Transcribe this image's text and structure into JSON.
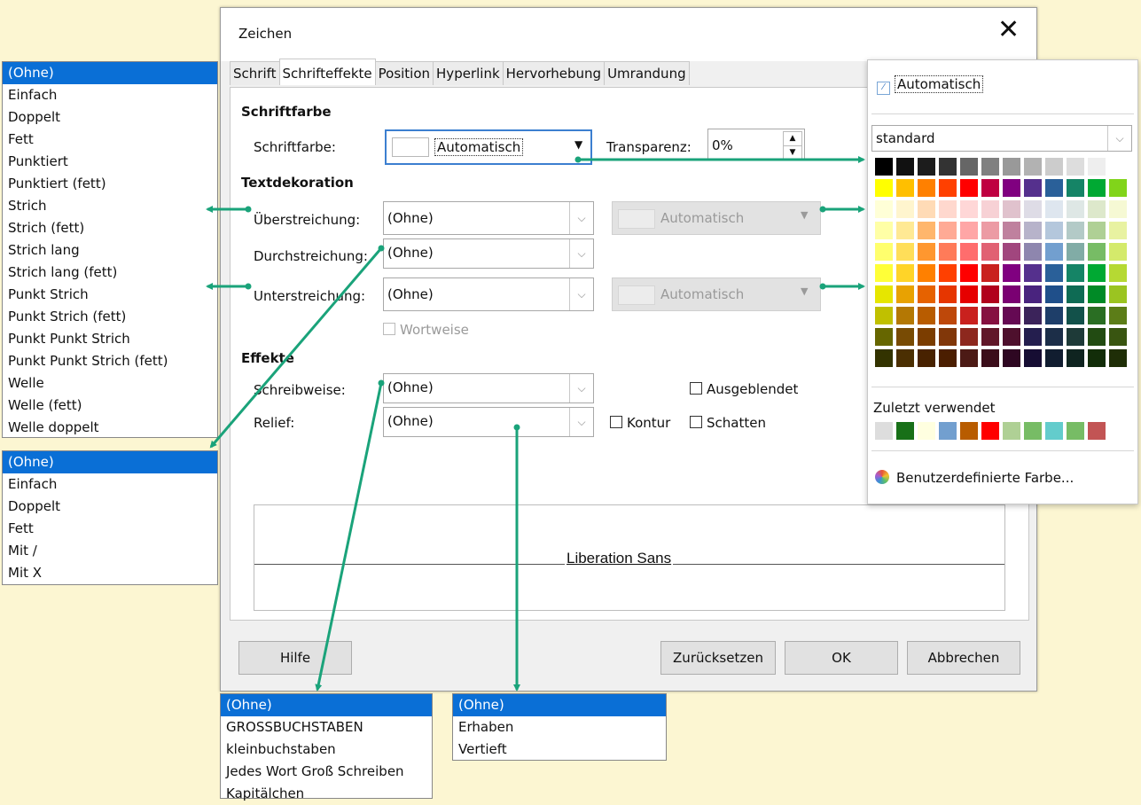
{
  "dialog": {
    "title": "Zeichen",
    "close": "✕",
    "tabs": [
      "Schrift",
      "Schrifteffekte",
      "Position",
      "Hyperlink",
      "Hervorhebung",
      "Umrandung"
    ],
    "active_tab": "Schrifteffekte",
    "sections": {
      "font_color": "Schriftfarbe",
      "decoration": "Textdekoration",
      "effects": "Effekte"
    },
    "font_color_label": "Schriftfarbe:",
    "font_color_value": "Automatisch",
    "transparency_label": "Transparenz:",
    "transparency_value": "0%",
    "overline_label": "Überstreichung:",
    "overline_value": "(Ohne)",
    "overline_color": "Automatisch",
    "strikeout_label": "Durchstreichung:",
    "strikeout_value": "(Ohne)",
    "underline_label": "Unterstreichung:",
    "underline_value": "(Ohne)",
    "underline_color": "Automatisch",
    "wordwise": "Wortweise",
    "case_label": "Schreibweise:",
    "case_value": "(Ohne)",
    "relief_label": "Relief:",
    "relief_value": "(Ohne)",
    "hidden": "Ausgeblendet",
    "outline": "Kontur",
    "shadow": "Schatten",
    "preview_text": "Liberation Sans",
    "buttons": {
      "help": "Hilfe",
      "reset": "Zurücksetzen",
      "ok": "OK",
      "cancel": "Abbrechen"
    }
  },
  "picker": {
    "auto": "Automatisch",
    "palette": "standard",
    "recent_label": "Zuletzt verwendet",
    "custom": "Benutzerdefinierte Farbe...",
    "grid": [
      [
        "#000000",
        "#111111",
        "#1c1c1c",
        "#333333",
        "#666666",
        "#808080",
        "#999999",
        "#b2b2b2",
        "#cccccc",
        "#dddddd",
        "#eeeeee",
        "#ffffff"
      ],
      [
        "#ffff00",
        "#ffbf00",
        "#ff8000",
        "#ff4000",
        "#ff0000",
        "#bf0041",
        "#800080",
        "#55308d",
        "#2a6099",
        "#158466",
        "#00a933",
        "#81d41a"
      ],
      [
        "#ffffd7",
        "#fff5ce",
        "#ffdbb6",
        "#ffd8ce",
        "#ffd7d7",
        "#f7d1d5",
        "#e0c2cd",
        "#dedce6",
        "#dee6ef",
        "#dee7e5",
        "#dde8cb",
        "#f6f9d4"
      ],
      [
        "#ffffa6",
        "#ffe994",
        "#ffb66c",
        "#ffaa95",
        "#ffa6a6",
        "#ec9ba4",
        "#bf819e",
        "#b7b3ca",
        "#b4c7dc",
        "#b3cac7",
        "#afd095",
        "#e8f2a1"
      ],
      [
        "#ffff6d",
        "#ffde59",
        "#ff972f",
        "#ff7b59",
        "#ff6d6d",
        "#e16173",
        "#a1467e",
        "#8e86ae",
        "#729fcf",
        "#81aca6",
        "#77bc65",
        "#d4ea6b"
      ],
      [
        "#ffff38",
        "#ffd428",
        "#ff8000",
        "#ff4000",
        "#ff0000",
        "#c9211e",
        "#800080",
        "#55308d",
        "#2a6099",
        "#158466",
        "#00a933",
        "#b6d933"
      ],
      [
        "#e6e600",
        "#e8a202",
        "#e66200",
        "#e63600",
        "#e60000",
        "#b1001c",
        "#7a0072",
        "#49237e",
        "#1f4f8a",
        "#0e6b54",
        "#008a26",
        "#9bc421"
      ],
      [
        "#c0c000",
        "#b47804",
        "#b85c00",
        "#be480a",
        "#c9211e",
        "#861141",
        "#650953",
        "#3b235a",
        "#1e3e69",
        "#12514a",
        "#2a6e23",
        "#5c7d18"
      ],
      [
        "#666600",
        "#784b04",
        "#7b3d00",
        "#813709",
        "#8d281e",
        "#611729",
        "#4e102d",
        "#241e4e",
        "#1c2e48",
        "#1e3a38",
        "#224b12",
        "#395511"
      ],
      [
        "#333300",
        "#4b2f02",
        "#482200",
        "#4b1e00",
        "#4c1a15",
        "#3b0d1a",
        "#2e0722",
        "#160d33",
        "#111d30",
        "#0f2420",
        "#122d09",
        "#1f2e07"
      ]
    ],
    "recent": [
      "#dddddd",
      "#187018",
      "#ffffe0",
      "#729fcf",
      "#b85c00",
      "#ff0000",
      "#afd095",
      "#77bc65",
      "#63cccc",
      "#77bc65",
      "#c25454"
    ]
  },
  "lists": {
    "line_styles": [
      "(Ohne)",
      "Einfach",
      "Doppelt",
      "Fett",
      "Punktiert",
      "Punktiert (fett)",
      "Strich",
      "Strich (fett)",
      "Strich lang",
      "Strich lang (fett)",
      "Punkt Strich",
      "Punkt Strich (fett)",
      "Punkt Punkt Strich",
      "Punkt Punkt Strich (fett)",
      "Welle",
      "Welle (fett)",
      "Welle doppelt"
    ],
    "strike_styles": [
      "(Ohne)",
      "Einfach",
      "Doppelt",
      "Fett",
      "Mit /",
      "Mit X"
    ],
    "case_styles": [
      "(Ohne)",
      "GROSSBUCHSTABEN",
      "kleinbuchstaben",
      "Jedes Wort Groß Schreiben",
      "Kapitälchen"
    ],
    "relief_styles": [
      "(Ohne)",
      "Erhaben",
      "Vertieft"
    ]
  },
  "accent": "#1aa37a"
}
